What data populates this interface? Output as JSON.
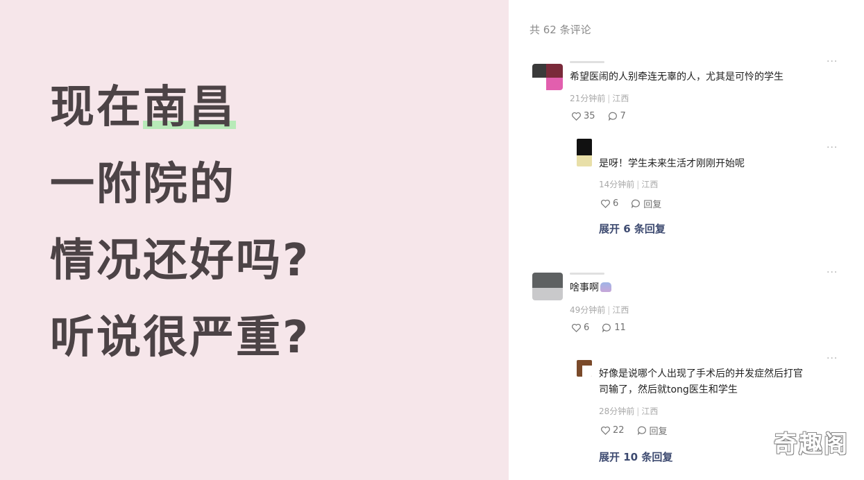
{
  "question": {
    "lines": [
      {
        "before": "现在",
        "highlight": "南昌"
      },
      {
        "before": "一附院的",
        "highlight": ""
      },
      {
        "before": "情况还好吗?",
        "highlight": ""
      },
      {
        "before": "听说很严重?",
        "highlight": ""
      }
    ],
    "highlight_color": "#b8eab8"
  },
  "comments_header": {
    "count_text": "共 62 条评论"
  },
  "comments": [
    {
      "text": "希望医闹的人别牵连无辜的人，尤其是可怜的学生",
      "time": "21分钟前",
      "region": "江西",
      "likes": "35",
      "replies": "7",
      "sub": {
        "text": "是呀！学生未来生活才刚刚开始呢",
        "time": "14分钟前",
        "region": "江西",
        "likes": "6",
        "reply_label": "回复"
      },
      "expand": "展开 6 条回复"
    },
    {
      "text": "啥事啊",
      "time": "49分钟前",
      "region": "江西",
      "likes": "6",
      "replies": "11",
      "sub": {
        "text_line1": "好像是说哪个人出现了手术后的并发症然后打官",
        "text_line2": "司输了，然后就tong医生和学生",
        "time": "28分钟前",
        "region": "江西",
        "likes": "22",
        "reply_label": "回复"
      },
      "expand": "展开 10 条回复"
    }
  ],
  "more_icon": "...",
  "watermark": "奇趣阁",
  "colors": {
    "left_bg": "#f6e6ea",
    "question_text": "#4c4346",
    "expand_text": "#3d4a70"
  }
}
